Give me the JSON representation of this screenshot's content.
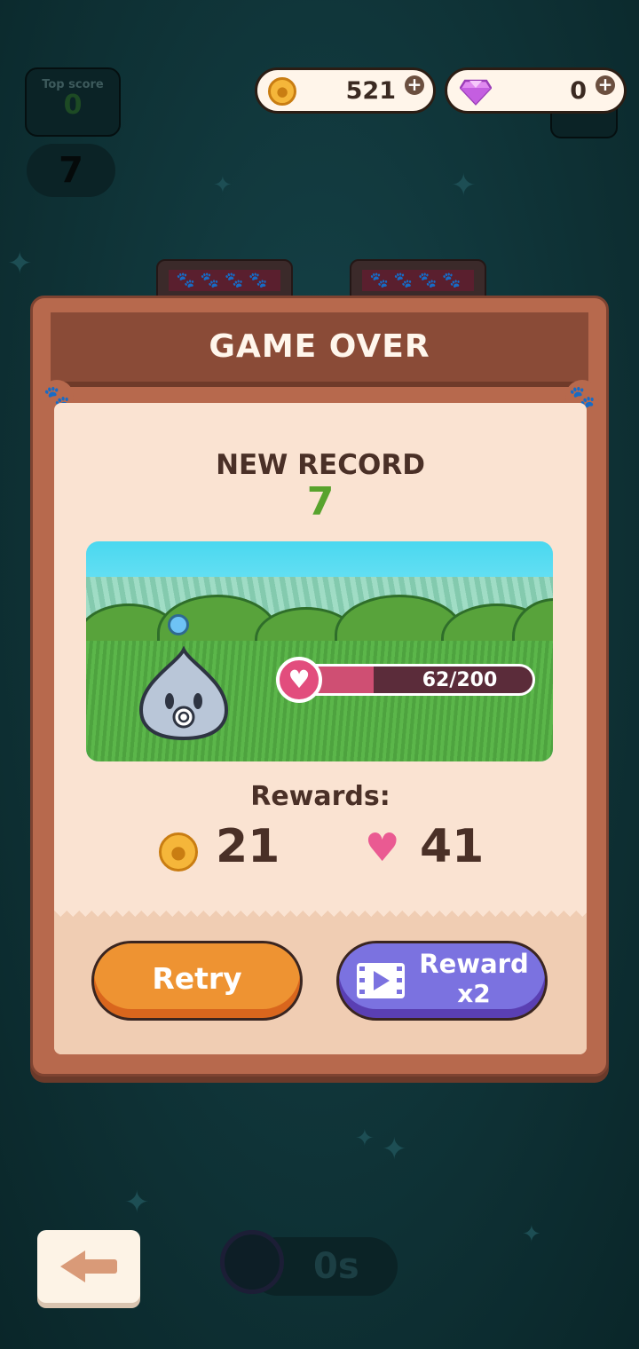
{
  "hud": {
    "top_score_label": "Top score",
    "top_score_value": "0",
    "current_score": "7",
    "coins": "521",
    "gems": "0",
    "plus": "+"
  },
  "dialog": {
    "title": "GAME OVER",
    "record_label": "NEW RECORD",
    "record_value": "7",
    "pet_bar": {
      "text": "62/200",
      "current": 62,
      "max": 200
    },
    "rewards_label": "Rewards:",
    "reward_coins": "21",
    "reward_hearts": "41",
    "retry_label": "Retry",
    "reward_label_line1": "Reward",
    "reward_label_line2": "x2"
  },
  "footer": {
    "timer": "0s"
  },
  "icons": {
    "coin": "paw-coin-icon",
    "gem": "gem-icon",
    "heart": "heart-icon",
    "video": "video-icon",
    "back": "back-arrow-icon",
    "stopwatch": "stopwatch-icon"
  },
  "colors": {
    "background": "#0f3337",
    "dialog_frame": "#b7694d",
    "title_bar": "#8a4b37",
    "record_green": "#58a32d",
    "retry_orange": "#ee9332",
    "reward_purple": "#7b72e0",
    "heart_pink": "#e24d7d"
  }
}
